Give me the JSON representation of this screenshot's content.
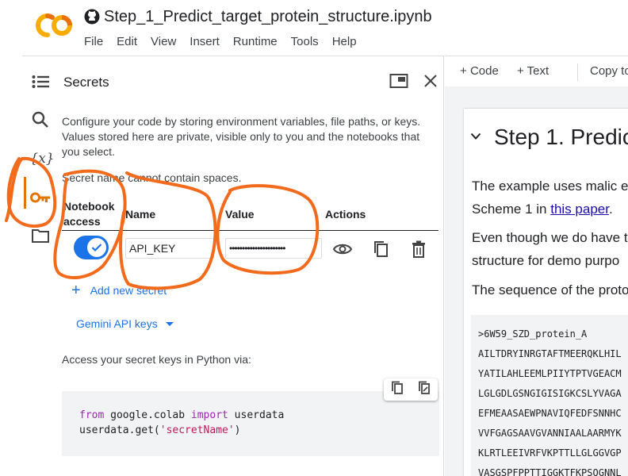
{
  "header": {
    "notebook_title": "Step_1_Predict_target_protein_structure.ipynb",
    "logo_text": "CO",
    "menu": [
      "File",
      "Edit",
      "View",
      "Insert",
      "Runtime",
      "Tools",
      "Help"
    ]
  },
  "rail": {
    "items": [
      "table-of-contents-icon",
      "search-icon",
      "variables-icon",
      "key-icon",
      "folder-icon"
    ],
    "variables_glyph": "{x}",
    "active": "key-icon"
  },
  "secrets": {
    "title": "Secrets",
    "description": "Configure your code by storing environment variables, file paths, or keys. Values stored here are private, visible only to you and the notebooks that you select.",
    "note": "Secret name cannot contain spaces.",
    "columns": {
      "access_line1": "Notebook",
      "access_line2": "access",
      "name": "Name",
      "value": "Value",
      "actions": "Actions"
    },
    "row": {
      "access_enabled": true,
      "name": "API_KEY",
      "value_masked": "••••••••••••••••••••••"
    },
    "add_label": "Add new secret",
    "gemini_label": "Gemini API keys",
    "access_text": "Access your secret keys in Python via:",
    "code": {
      "line1_kw1": "from",
      "line1_mod": " google.colab ",
      "line1_kw2": "import",
      "line1_name": " userdata",
      "line2_prefix": "userdata.get(",
      "line2_str": "'secretName'",
      "line2_suffix": ")"
    }
  },
  "notebook": {
    "toolbar": {
      "code_label": "Code",
      "text_label": "Text",
      "copy_label": "Copy to"
    },
    "heading": "Step 1. Predic",
    "p1_line1": "The example uses malic e",
    "p1_line2_prefix": "Scheme 1 in ",
    "p1_link": "this paper",
    "p1_line2_suffix": ".",
    "p2_line1": "Even though we do have t",
    "p2_line2": "structure for demo purpo",
    "p3_line1": "The sequence of the proto",
    "sequence": [
      ">6W59_SZD_protein_A",
      "AILTDRYINRGTAFTMEERQKLHIL",
      "YATILAHLEEMLPIIYTPTVGEACM",
      "LGLGDLGSNGIGISIGKCSLYVAGA",
      "EFMEAASAEWPNAVIQFEDFSNNHC",
      "VVFGAGSAAVGVANNIAALAARMYK",
      "KLRTLEEIVRFVKPTTLLGLGGVGP",
      "VASGSPFPPTTIGGKTFKPSQGNNL"
    ]
  },
  "colors": {
    "annotation": "#f26a1b",
    "accent": "#1a73e8",
    "active_rail": "#e37400"
  }
}
